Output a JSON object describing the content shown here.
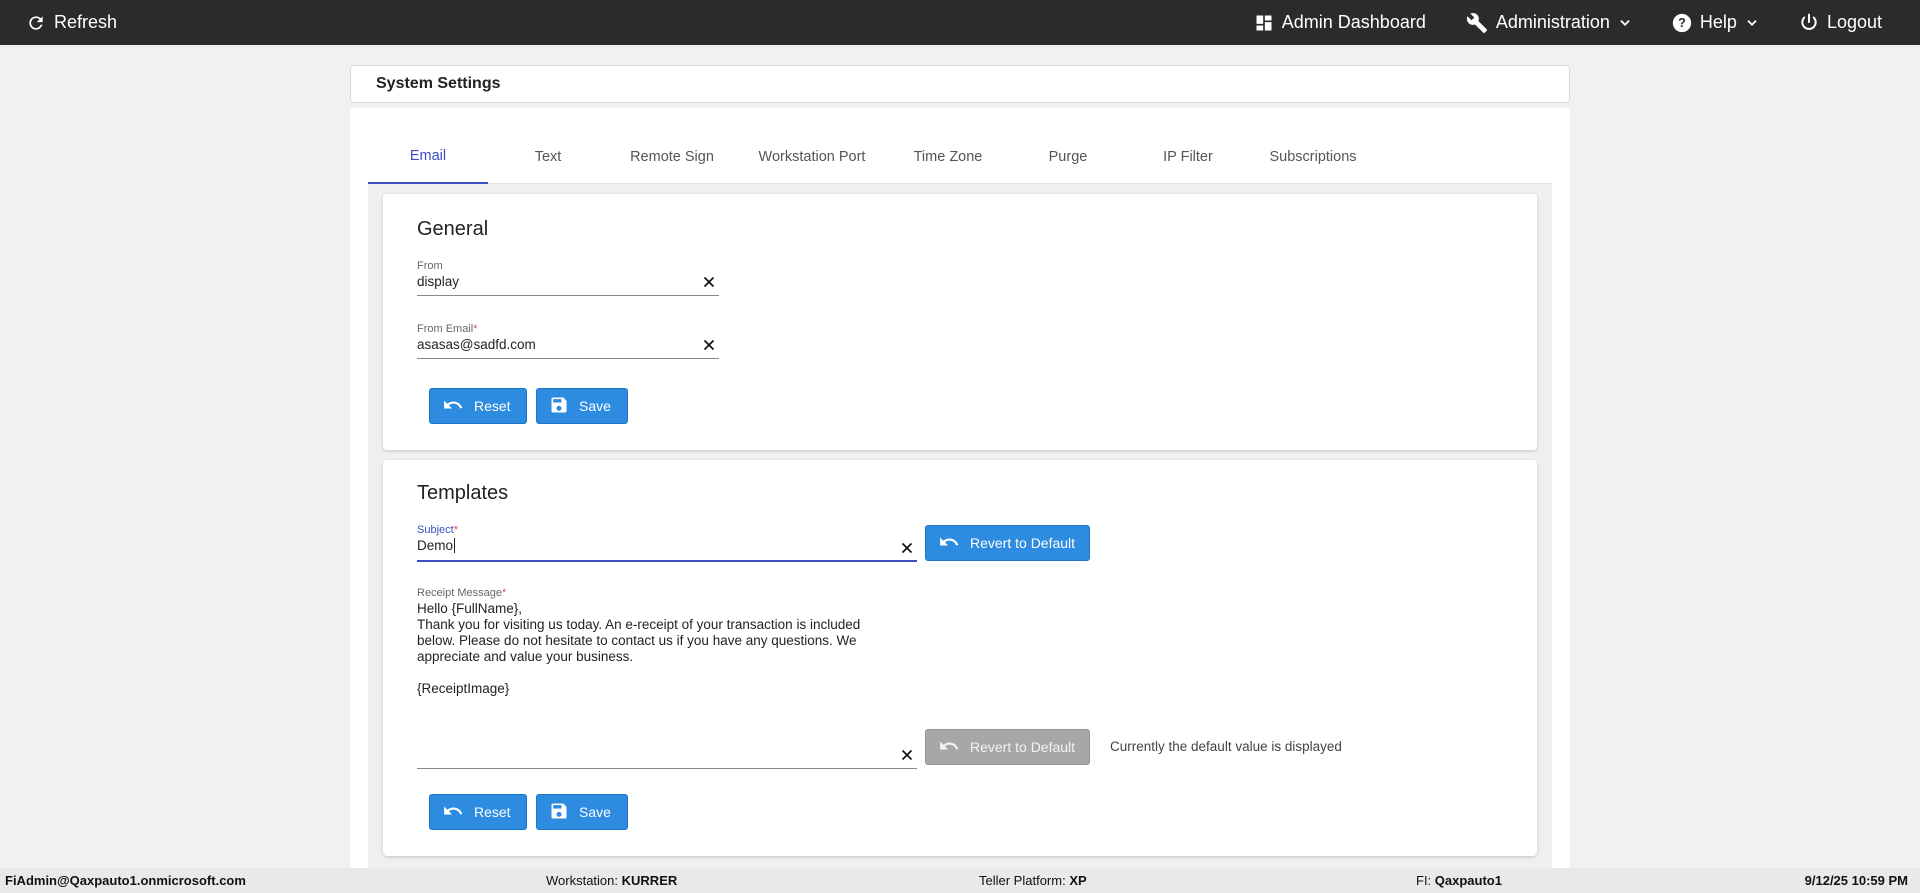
{
  "topbar": {
    "refresh_label": "Refresh",
    "admin_dashboard_label": "Admin Dashboard",
    "administration_label": "Administration",
    "help_label": "Help",
    "logout_label": "Logout"
  },
  "page": {
    "title": "System Settings"
  },
  "tabs": [
    {
      "label": "Email",
      "active": true
    },
    {
      "label": "Text"
    },
    {
      "label": "Remote Sign"
    },
    {
      "label": "Workstation Port"
    },
    {
      "label": "Time Zone"
    },
    {
      "label": "Purge"
    },
    {
      "label": "IP Filter"
    },
    {
      "label": "Subscriptions"
    }
  ],
  "general": {
    "heading": "General",
    "from": {
      "label": "From",
      "value": "display"
    },
    "from_email": {
      "label": "From Email",
      "required_mark": "*",
      "value": "asasas@sadfd.com"
    },
    "reset_label": "Reset",
    "save_label": "Save"
  },
  "templates": {
    "heading": "Templates",
    "subject": {
      "label": "Subject",
      "required_mark": "*",
      "value": "Demo"
    },
    "receipt_message": {
      "label": "Receipt Message",
      "required_mark": "*",
      "value": "Hello {FullName},\nThank you for visiting us today. An e-receipt of your transaction is included\nbelow. Please do not hesitate to contact us if you have any questions. We\nappreciate and value your business.\n\n{ReceiptImage}"
    },
    "revert_label": "Revert to Default",
    "default_note": "Currently the default value is displayed",
    "reset_label": "Reset",
    "save_label": "Save"
  },
  "statusbar": {
    "user": "FiAdmin@Qaxpauto1.onmicrosoft.com",
    "workstation_label": "Workstation:",
    "workstation_value": "KURRER",
    "platform_label": "Teller Platform:",
    "platform_value": "XP",
    "fi_label": "FI:",
    "fi_value": "Qaxpauto1",
    "datetime": "9/12/25 10:59 PM"
  },
  "colors": {
    "topbar_bg": "#2b2b2b",
    "accent": "#3b4fbf",
    "button_blue": "#2d8be0",
    "button_disabled": "#a7a7a7"
  },
  "icons": {
    "refresh": "refresh-icon",
    "dashboard": "dashboard-icon",
    "wrench": "wrench-icon",
    "help": "help-circle-icon",
    "power": "power-icon",
    "undo": "undo-icon",
    "save": "floppy-disk-icon",
    "clear": "close-icon",
    "chevron": "chevron-down-icon"
  }
}
